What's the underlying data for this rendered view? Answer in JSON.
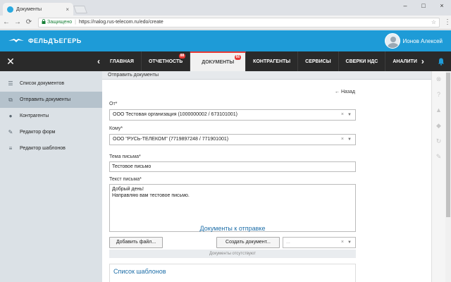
{
  "browser": {
    "tab_title": "Документы",
    "tab_close": "×",
    "window_controls": [
      "–",
      "□",
      "×"
    ],
    "back": "←",
    "forward": "→",
    "reload": "⟳",
    "secure_label": "Защищено",
    "separator": "|",
    "url": "https://nalog.rus-telecom.ru/edo/create",
    "star": "☆",
    "menu": "⋮"
  },
  "app": {
    "brand": "ФЕЛЬДЪЕГЕРЬ",
    "user_name": "Ионов Алексей",
    "brand_color": "#1e9bd7"
  },
  "nav": {
    "close": "✕",
    "prev": "‹",
    "next": "›",
    "tabs": [
      {
        "label": "ГЛАВНАЯ",
        "badge": ""
      },
      {
        "label": "ОТЧЕТНОСТЬ",
        "badge": "88"
      },
      {
        "label": "ДОКУМЕНТЫ",
        "badge": "66"
      },
      {
        "label": "КОНТРАГЕНТЫ",
        "badge": ""
      },
      {
        "label": "СЕРВИСЫ",
        "badge": ""
      },
      {
        "label": "СВЕРКИ НДС",
        "badge": ""
      },
      {
        "label": "АНАЛИТИ",
        "badge": ""
      }
    ]
  },
  "sidebar": {
    "items": [
      {
        "label": "Список документов",
        "icon": "list-icon"
      },
      {
        "label": "Отправить документы",
        "icon": "send-icon"
      },
      {
        "label": "Контрагенты",
        "icon": "contacts-icon"
      },
      {
        "label": "Редактор форм",
        "icon": "form-editor-icon"
      },
      {
        "label": "Редактор шаблонов",
        "icon": "template-editor-icon"
      }
    ]
  },
  "main": {
    "breadcrumb": "Отправить документы",
    "back_label": "Назад",
    "back_arrow": "←",
    "from_label": "От*",
    "from_value": "ООО Тестовая организация (1000000002 / 673101001)",
    "to_label": "Кому*",
    "to_value": "ООО \"РУСЬ-ТЕЛЕКОМ\" (7719897248 / 771901001)",
    "subject_label": "Тема письма*",
    "subject_value": "Тестовое письмо",
    "body_label": "Текст письма*",
    "body_line1": "Добрый день!",
    "body_line2": "Направляю вам тестовое письмо.",
    "docs_title": "Документы к отправке",
    "add_file": "Добавить файл...",
    "create_doc": "Создать документ...",
    "doc_type_placeholder": "...",
    "no_docs": "Документы отсутствуют",
    "templates_title": "Список шаблонов",
    "clear_x": "×",
    "caret": "▼"
  }
}
